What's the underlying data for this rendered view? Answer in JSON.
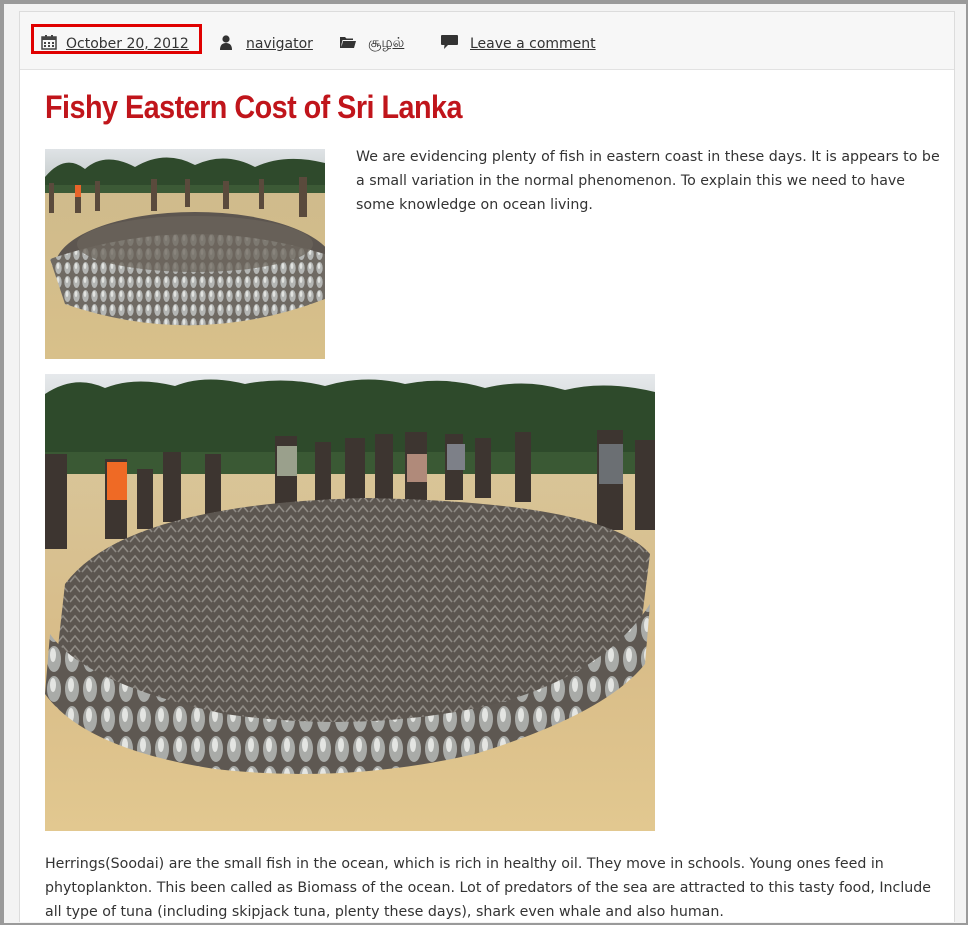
{
  "meta": {
    "date": "October 20, 2012",
    "author": "navigator",
    "category": "சூழல்",
    "comment_link": "Leave a comment",
    "highlight_color": "#e00000"
  },
  "post": {
    "title": "Fishy Eastern Cost of Sri Lanka",
    "title_color": "#c0151b",
    "intro_paragraph": "We are evidencing plenty of fish in eastern coast in these days. It is appears to be a small variation in the normal phenomenon. To explain this we need to have some knowledge on ocean living.",
    "body_paragraph": "Herrings(Soodai) are the small fish in the ocean, which is rich in healthy oil. They move in schools. Young ones feed in phytoplankton. This been called as Biomass of the ocean. Lot of predators of the sea are attracted to this tasty food, Include all type of tuna (including skipjack tuna, plenty these days), shark even whale and also human."
  },
  "icons": {
    "date": "calendar-icon",
    "author": "user-icon",
    "category": "folder-icon",
    "comments": "comment-icon"
  }
}
